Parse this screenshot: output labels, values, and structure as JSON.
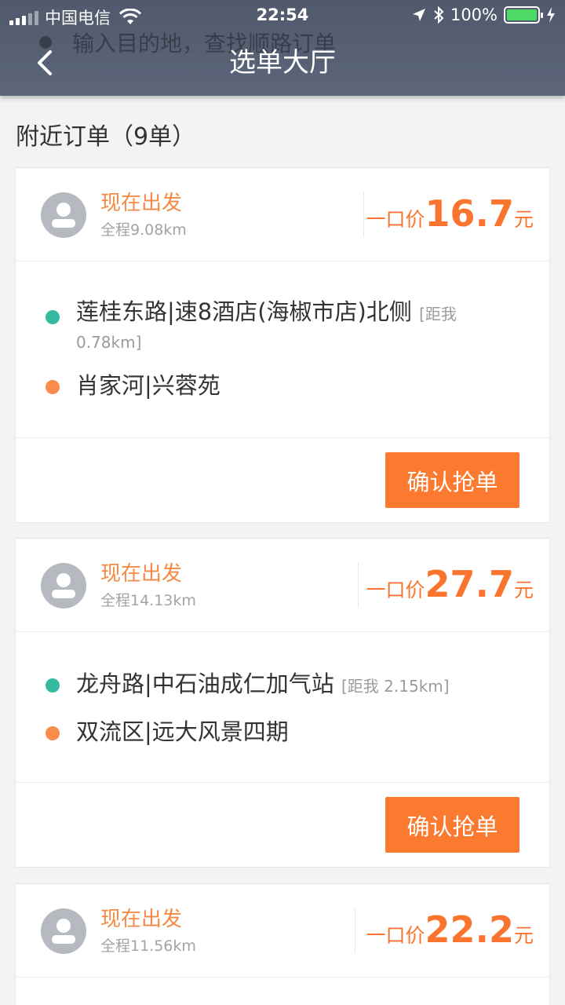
{
  "status_bar": {
    "carrier": "中国电信",
    "time": "22:54",
    "battery": "100%",
    "battery_level": 1.0
  },
  "search_hint": "输入目的地，查找顺路订单",
  "header": {
    "title": "选单大厅",
    "back_icon": "chevron-left-icon"
  },
  "section_title": "附近订单（9单）",
  "orders": [
    {
      "depart": "现在出发",
      "distance": "全程9.08km",
      "price_label": "一口价",
      "price": "16.7",
      "price_unit": "元",
      "start": "莲桂东路|速8酒店(海椒市店)北侧",
      "start_near": "[距我 0.78km]",
      "end": "肖家河|兴蓉苑",
      "button": "确认抢单"
    },
    {
      "depart": "现在出发",
      "distance": "全程14.13km",
      "price_label": "一口价",
      "price": "27.7",
      "price_unit": "元",
      "start": "龙舟路|中石油成仁加气站",
      "start_near": "[距我 2.15km]",
      "end": "双流区|远大风景四期",
      "button": "确认抢单"
    },
    {
      "depart": "现在出发",
      "distance": "全程11.56km",
      "price_label": "一口价",
      "price": "22.2",
      "price_unit": "元"
    }
  ],
  "colors": {
    "header_bg": "#565f72",
    "accent": "#fc7a2f",
    "start_dot": "#35b9a0",
    "end_dot": "#f98c4a"
  }
}
